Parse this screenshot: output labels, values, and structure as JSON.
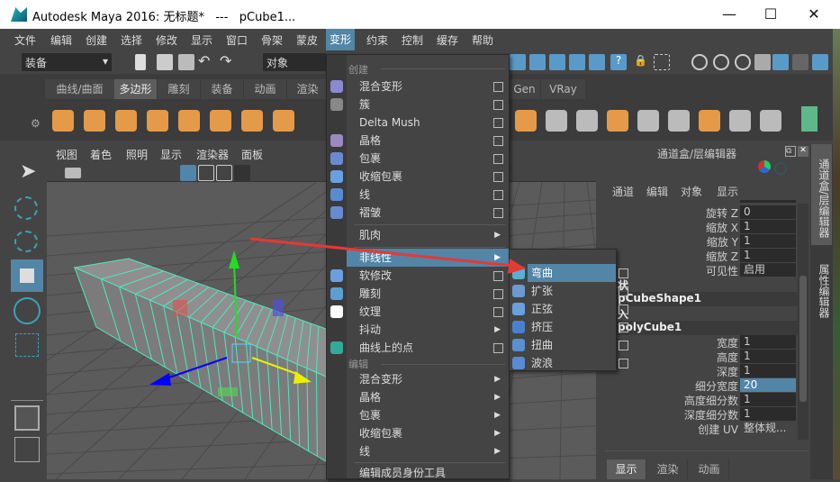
{
  "window": {
    "title": "Autodesk Maya 2016: 无标题*   ---   pCube1...",
    "minimize": "—",
    "maximize": "☐",
    "close": "✕"
  },
  "menubar": [
    "文件",
    "编辑",
    "创建",
    "选择",
    "修改",
    "显示",
    "窗口",
    "骨架",
    "蒙皮",
    "变形",
    "约束",
    "控制",
    "缓存",
    "帮助"
  ],
  "active_menu": "变形",
  "toolbar": {
    "mode": "装备",
    "selection_field": "对象"
  },
  "shelf": {
    "tabs": [
      "曲线/曲面",
      "多边形",
      "雕刻",
      "装备",
      "动画",
      "渲染",
      "Gen",
      "VRay"
    ],
    "active_tab": "多边形"
  },
  "viewport": {
    "menus": [
      "视图",
      "着色",
      "照明",
      "显示",
      "渲染器",
      "面板"
    ],
    "subdivisions": 20
  },
  "deform_menu": {
    "header_create": "创建",
    "items": [
      {
        "label": "混合变形",
        "type": "option"
      },
      {
        "label": "簇",
        "type": "option"
      },
      {
        "label": "Delta Mush",
        "type": "option"
      },
      {
        "label": "晶格",
        "type": "option"
      },
      {
        "label": "包裹",
        "type": "option"
      },
      {
        "label": "收缩包裹",
        "type": "option"
      },
      {
        "label": "线",
        "type": "option"
      },
      {
        "label": "褶皱",
        "type": "option"
      },
      {
        "label": "肌肉",
        "type": "submenu"
      },
      {
        "label": "非线性",
        "type": "submenu",
        "highlighted": true
      },
      {
        "label": "软修改",
        "type": "option"
      },
      {
        "label": "雕刻",
        "type": "option"
      },
      {
        "label": "纹理",
        "type": "option"
      },
      {
        "label": "抖动",
        "type": "submenu"
      },
      {
        "label": "曲线上的点",
        "type": "option"
      }
    ],
    "header_edit": "编辑",
    "edit_items": [
      {
        "label": "混合变形"
      },
      {
        "label": "晶格"
      },
      {
        "label": "包裹"
      },
      {
        "label": "收缩包裹"
      },
      {
        "label": "线"
      }
    ],
    "last_item": "编辑成员身份工具"
  },
  "nonlinear_submenu": [
    {
      "label": "弯曲",
      "highlighted": true
    },
    {
      "label": "扩张"
    },
    {
      "label": "正弦"
    },
    {
      "label": "挤压"
    },
    {
      "label": "扭曲"
    },
    {
      "label": "波浪"
    }
  ],
  "channel_box": {
    "title": "通道盒/层编辑器",
    "menus": [
      "通道",
      "编辑",
      "对象",
      "显示"
    ],
    "rows": [
      {
        "label": "旋转 Z",
        "value": "0"
      },
      {
        "label": "缩放 X",
        "value": "1"
      },
      {
        "label": "缩放 Y",
        "value": "1"
      },
      {
        "label": "缩放 Z",
        "value": "1"
      },
      {
        "label": "可见性",
        "value": "启用"
      }
    ],
    "shape_header": "状",
    "shape_name": "pCubeShape1",
    "input_header": "入",
    "input_name": "polyCube1",
    "input_rows": [
      {
        "label": "宽度",
        "value": "1"
      },
      {
        "label": "高度",
        "value": "1"
      },
      {
        "label": "深度",
        "value": "1"
      },
      {
        "label": "细分宽度",
        "value": "20",
        "selected": true
      },
      {
        "label": "高度细分数",
        "value": "1"
      },
      {
        "label": "深度细分数",
        "value": "1"
      },
      {
        "label": "创建 UV",
        "value": "整体规..."
      }
    ],
    "bottom_tabs": [
      "显示",
      "渲染",
      "动画"
    ],
    "active_bottom_tab": "显示"
  },
  "side_tabs": [
    "通道盒/层编辑器",
    "属性编辑器"
  ],
  "colors": {
    "accent": "#5285a6",
    "wireframe": "#4ee8c0",
    "shelf_icon": "#e59a4a",
    "annotation_arrow": "#e53935"
  }
}
